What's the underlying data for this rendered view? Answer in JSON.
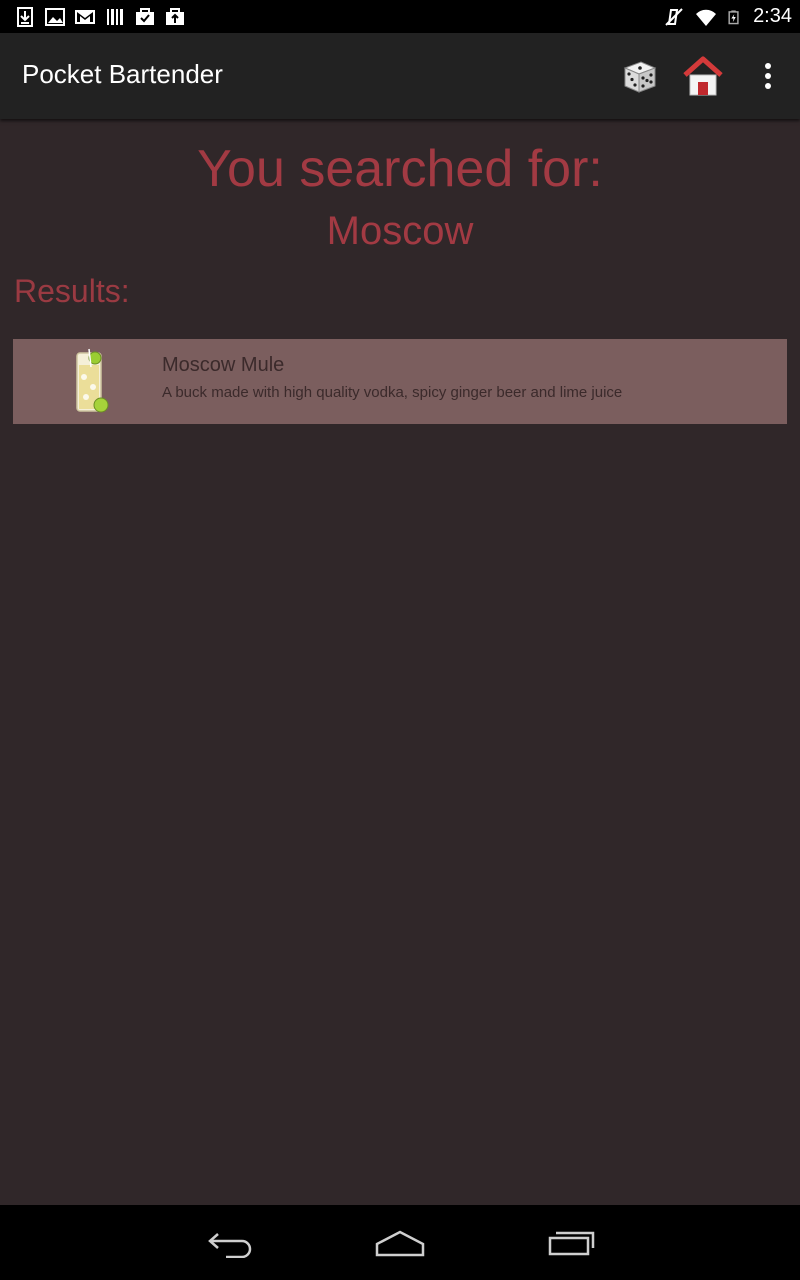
{
  "status_bar": {
    "time": "2:34",
    "left_icons": [
      "download-icon",
      "image-icon",
      "gmail-icon",
      "barcode-icon",
      "briefcase-check-icon",
      "briefcase-upload-icon"
    ],
    "right_icons": [
      "mute-icon",
      "wifi-icon",
      "battery-icon"
    ]
  },
  "action_bar": {
    "title": "Pocket Bartender",
    "actions": [
      "dice-icon",
      "home-icon",
      "overflow-menu-icon"
    ]
  },
  "search": {
    "heading": "You searched for:",
    "term": "Moscow"
  },
  "results": {
    "label": "Results:",
    "items": [
      {
        "title": "Moscow Mule",
        "description": "A buck made with high quality vodka, spicy ginger beer and lime juice",
        "icon": "cocktail-glass-icon"
      }
    ]
  },
  "nav_bar": {
    "buttons": [
      "back-icon",
      "home-nav-icon",
      "recents-icon"
    ]
  },
  "colors": {
    "background": "#302729",
    "accent": "#a23a43",
    "result_row": "#7b5e5e",
    "action_bar": "#222222"
  }
}
